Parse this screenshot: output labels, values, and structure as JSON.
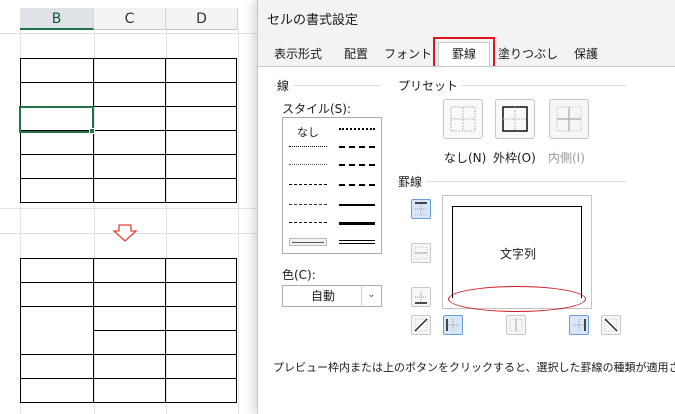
{
  "sheet": {
    "columns": [
      "B",
      "C",
      "D"
    ],
    "selected_column": "B"
  },
  "dialog": {
    "title": "セルの書式設定",
    "tabs": [
      "表示形式",
      "配置",
      "フォント",
      "罫線",
      "塗りつぶし",
      "保護"
    ],
    "active_tab": "罫線",
    "line_group": {
      "label": "線",
      "style_label": "スタイル(S):",
      "none_label": "なし"
    },
    "color": {
      "label": "色(C):",
      "value": "自動"
    },
    "presets": {
      "label": "プリセット",
      "items": [
        {
          "label": "なし(N)",
          "icon": "preset-none-icon",
          "enabled": true
        },
        {
          "label": "外枠(O)",
          "icon": "preset-outline-icon",
          "enabled": true
        },
        {
          "label": "内側(I)",
          "icon": "preset-inside-icon",
          "enabled": false
        }
      ]
    },
    "border": {
      "label": "罫線",
      "preview_text": "文字列"
    },
    "hint": "プレビュー枠内または上のボタンをクリックすると、選択した罫線の種類が適用されます。"
  },
  "colors": {
    "highlight_red": "#e0141b",
    "excel_green": "#217346",
    "pressed_blue": "#d8e6f7"
  }
}
